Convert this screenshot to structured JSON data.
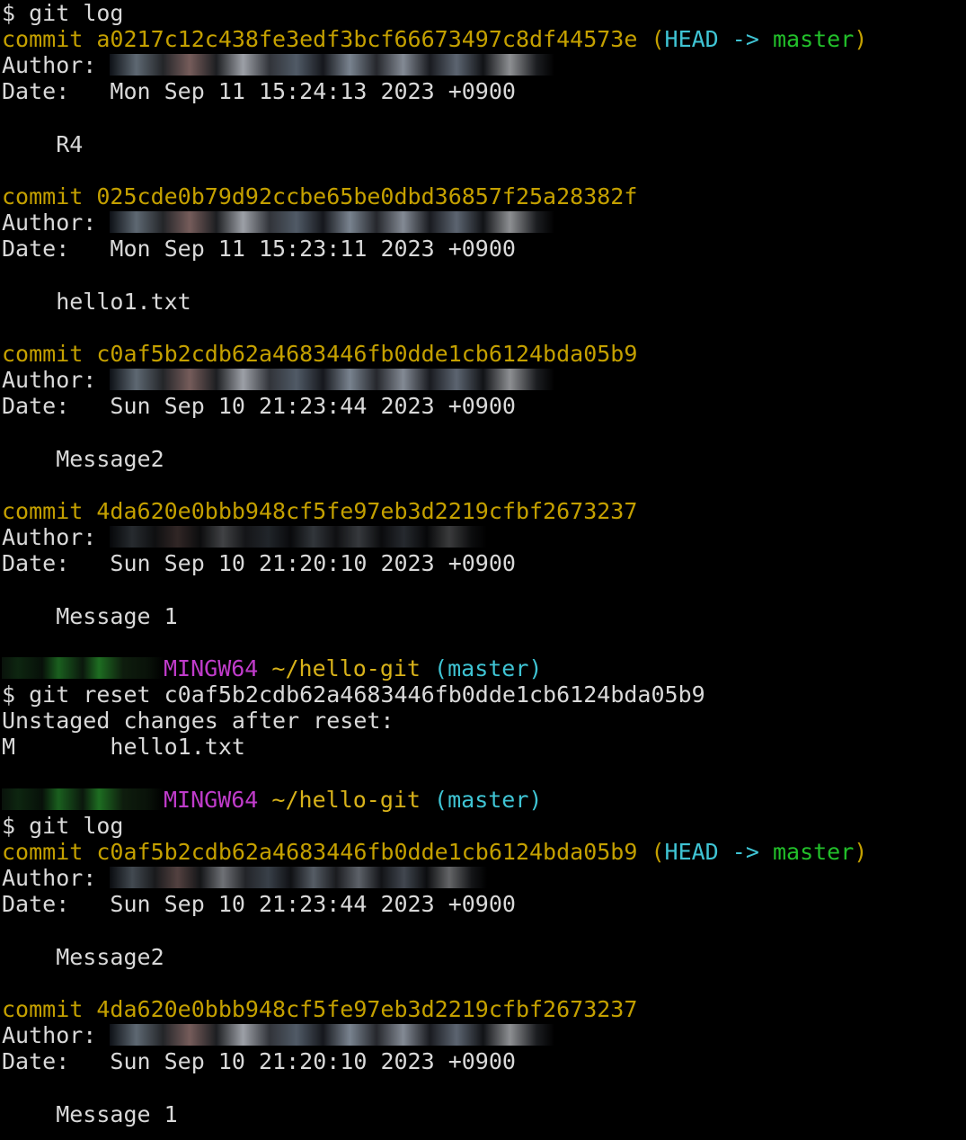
{
  "terminal": {
    "lines": {
      "l01": {
        "prompt": "$ ",
        "cmd": "git log"
      },
      "l02": {
        "kw": "commit ",
        "hash": "a0217c12c438fe3edf3bcf66673497c8df44573e",
        "paren_open": " (",
        "head": "HEAD",
        "arrow": " -> ",
        "branch": "master",
        "paren_close": ")"
      },
      "l03": {
        "label": "Author: "
      },
      "l04": {
        "label": "Date:   ",
        "value": "Mon Sep 11 15:24:13 2023 +0900"
      },
      "l06": {
        "msg": "    R4"
      },
      "l08": {
        "kw": "commit ",
        "hash": "025cde0b79d92ccbe65be0dbd36857f25a28382f"
      },
      "l09": {
        "label": "Author: "
      },
      "l10": {
        "label": "Date:   ",
        "value": "Mon Sep 11 15:23:11 2023 +0900"
      },
      "l12": {
        "msg": "    hello1.txt"
      },
      "l14": {
        "kw": "commit ",
        "hash": "c0af5b2cdb62a4683446fb0dde1cb6124bda05b9"
      },
      "l15": {
        "label": "Author: "
      },
      "l16": {
        "label": "Date:   ",
        "value": "Sun Sep 10 21:23:44 2023 +0900"
      },
      "l18": {
        "msg": "    Message2"
      },
      "l20": {
        "kw": "commit ",
        "hash": "4da620e0bbb948cf5fe97eb3d2219cfbf2673237"
      },
      "l21": {
        "label": "Author: "
      },
      "l22": {
        "label": "Date:   ",
        "value": "Sun Sep 10 21:20:10 2023 +0900"
      },
      "l24": {
        "msg": "    Message 1"
      },
      "l26": {
        "env": "MINGW64",
        "path": " ~/hello-git",
        "branch": " (master)"
      },
      "l27": {
        "prompt": "$ ",
        "cmd": "git reset c0af5b2cdb62a4683446fb0dde1cb6124bda05b9"
      },
      "l28": {
        "text": "Unstaged changes after reset:"
      },
      "l29": {
        "status": "M",
        "file": "       hello1.txt"
      },
      "l31": {
        "env": "MINGW64",
        "path": " ~/hello-git",
        "branch": " (master)"
      },
      "l32": {
        "prompt": "$ ",
        "cmd": "git log"
      },
      "l33": {
        "kw": "commit ",
        "hash": "c0af5b2cdb62a4683446fb0dde1cb6124bda05b9",
        "paren_open": " (",
        "head": "HEAD",
        "arrow": " -> ",
        "branch": "master",
        "paren_close": ")"
      },
      "l34": {
        "label": "Author: "
      },
      "l35": {
        "label": "Date:   ",
        "value": "Sun Sep 10 21:23:44 2023 +0900"
      },
      "l37": {
        "msg": "    Message2"
      },
      "l39": {
        "kw": "commit ",
        "hash": "4da620e0bbb948cf5fe97eb3d2219cfbf2673237"
      },
      "l40": {
        "label": "Author: "
      },
      "l41": {
        "label": "Date:   ",
        "value": "Sun Sep 10 21:20:10 2023 +0900"
      },
      "l43": {
        "msg": "    Message 1"
      }
    }
  },
  "colors": {
    "background": "#000000",
    "text": "#d9d9d9",
    "commit": "#c4a000",
    "head": "#3fc4d4",
    "branch": "#22c02a",
    "mingw": "#c03ccb",
    "path": "#d8b21a"
  }
}
